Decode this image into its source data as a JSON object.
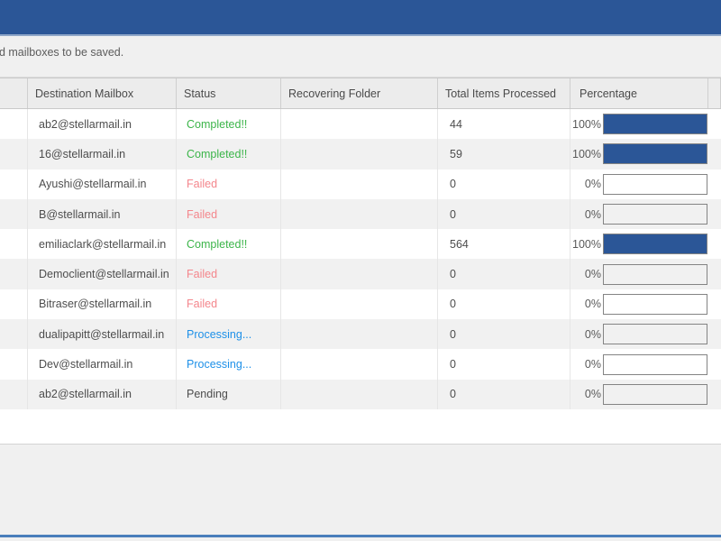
{
  "window": {
    "titlebar_color": "#2B5697",
    "accent_color": "#2B5697"
  },
  "instruction": {
    "text": "ed mailboxes to be saved."
  },
  "grid": {
    "columns": [
      {
        "key": "select",
        "label": ""
      },
      {
        "key": "mailbox",
        "label": "Destination Mailbox"
      },
      {
        "key": "status",
        "label": "Status"
      },
      {
        "key": "folder",
        "label": "Recovering Folder"
      },
      {
        "key": "total",
        "label": "Total Items Processed"
      },
      {
        "key": "percent",
        "label": "Percentage"
      }
    ],
    "status_colors": {
      "Completed!!": "#3CB54A",
      "Failed": "#F4868C",
      "Processing...": "#1E90E8",
      "Pending": "#4D4D4D"
    },
    "rows": [
      {
        "mailbox": "ab2@stellarmail.in",
        "status": "Completed!!",
        "folder": "",
        "total": "44",
        "percent": "100%",
        "progress": 100
      },
      {
        "mailbox": "16@stellarmail.in",
        "status": "Completed!!",
        "folder": "",
        "total": "59",
        "percent": "100%",
        "progress": 100
      },
      {
        "mailbox": "Ayushi@stellarmail.in",
        "status": "Failed",
        "folder": "",
        "total": "0",
        "percent": "0%",
        "progress": 0
      },
      {
        "mailbox": "B@stellarmail.in",
        "status": "Failed",
        "folder": "",
        "total": "0",
        "percent": "0%",
        "progress": 0
      },
      {
        "mailbox": "emiliaclark@stellarmail.in",
        "status": "Completed!!",
        "folder": "",
        "total": "564",
        "percent": "100%",
        "progress": 100
      },
      {
        "mailbox": "Democlient@stellarmail.in",
        "status": "Failed",
        "folder": "",
        "total": "0",
        "percent": "0%",
        "progress": 0
      },
      {
        "mailbox": "Bitraser@stellarmail.in",
        "status": "Failed",
        "folder": "",
        "total": "0",
        "percent": "0%",
        "progress": 0
      },
      {
        "mailbox": "dualipapitt@stellarmail.in",
        "status": "Processing...",
        "folder": "",
        "total": "0",
        "percent": "0%",
        "progress": 0
      },
      {
        "mailbox": "Dev@stellarmail.in",
        "status": "Processing...",
        "folder": "",
        "total": "0",
        "percent": "0%",
        "progress": 0
      },
      {
        "mailbox": "ab2@stellarmail.in",
        "status": "Pending",
        "folder": "",
        "total": "0",
        "percent": "0%",
        "progress": 0
      }
    ]
  }
}
